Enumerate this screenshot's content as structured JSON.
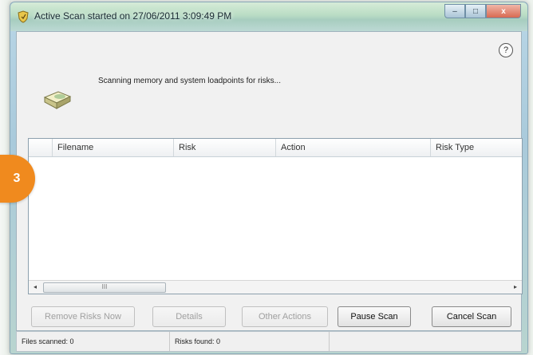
{
  "window": {
    "title": "Active Scan started on 27/06/2011 3:09:49 PM",
    "controls": {
      "minimize": "–",
      "maximize": "□",
      "close": "x"
    }
  },
  "help_icon": "?",
  "icons": {
    "app": "shield-icon",
    "scan": "scanner-icon",
    "help": "help-icon"
  },
  "status_message": "Scanning memory and system loadpoints for risks...",
  "results_table": {
    "columns": [
      "",
      "Filename",
      "Risk",
      "Action",
      "Risk Type"
    ],
    "rows": []
  },
  "scrollbar": {
    "left_arrow": "◂",
    "right_arrow": "▸",
    "thumb_grip": "III"
  },
  "buttons": {
    "remove_risks_now": "Remove Risks Now",
    "details": "Details",
    "other_actions": "Other Actions",
    "pause_scan": "Pause Scan",
    "cancel_scan": "Cancel Scan"
  },
  "statusbar": {
    "files_scanned": "Files scanned: 0",
    "risks_found": "Risks found: 0"
  },
  "step_badge": "3",
  "colors": {
    "badge": "#f08a1e",
    "title_glass": "#b9dcc4"
  }
}
